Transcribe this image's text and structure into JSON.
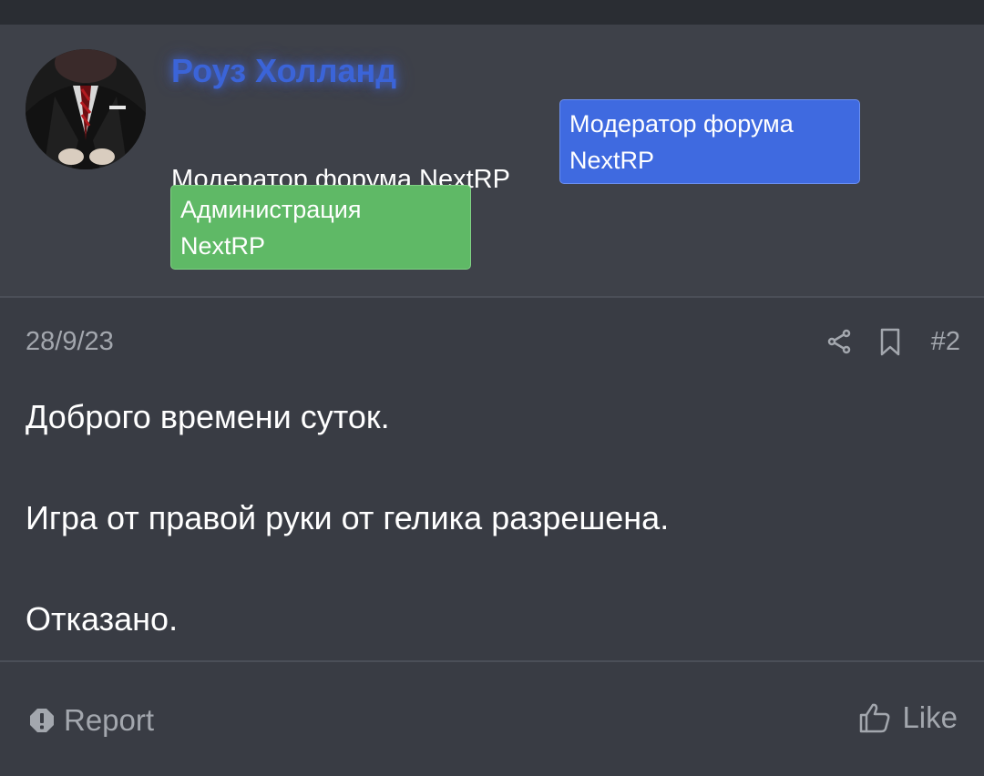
{
  "post": {
    "author": {
      "name": "Роуз Холланд",
      "title": "Модератор форума NextRP",
      "banners": [
        {
          "label_line1": "Модератор форума",
          "label_line2": "NextRP",
          "color": "#3f6ae0"
        },
        {
          "label_line1": "Администрация",
          "label_line2": "NextRP",
          "color": "#5fb966"
        }
      ],
      "avatar_icon": "suit-man-avatar"
    },
    "date": "28/9/23",
    "number": "#2",
    "actions": {
      "share_icon": "share-icon",
      "bookmark_icon": "bookmark-icon"
    },
    "body": [
      "Доброго времени суток.",
      "Игра от правой руки от гелика разрешена.",
      "Отказано."
    ],
    "footer": {
      "report_label": "Report",
      "like_label": "Like"
    }
  },
  "colors": {
    "username": "#3b64d8",
    "background": "#393c44",
    "muted_text": "#a3a7ae"
  }
}
